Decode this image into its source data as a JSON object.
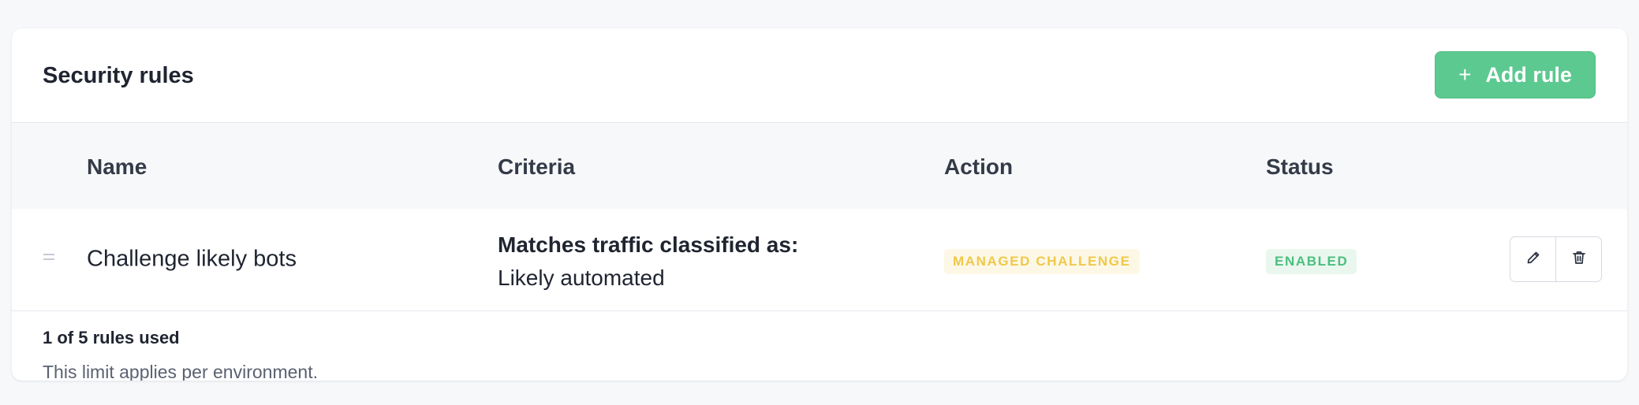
{
  "header": {
    "title": "Security rules",
    "add_button_label": "Add rule",
    "add_button_icon": "plus-icon",
    "accent_color": "#5cc990"
  },
  "table": {
    "columns": [
      "Name",
      "Criteria",
      "Action",
      "Status"
    ],
    "rows": [
      {
        "name": "Challenge likely bots",
        "criteria_heading": "Matches traffic classified as:",
        "criteria_value": "Likely automated",
        "action": "MANAGED CHALLENGE",
        "status": "ENABLED",
        "action_color": "#f0c84a",
        "status_color": "#4bbf7e",
        "icons": [
          "drag-handle-icon",
          "pencil-icon",
          "trash-icon"
        ]
      }
    ]
  },
  "footer": {
    "usage": "1 of 5 rules used",
    "note": "This limit applies per environment."
  }
}
